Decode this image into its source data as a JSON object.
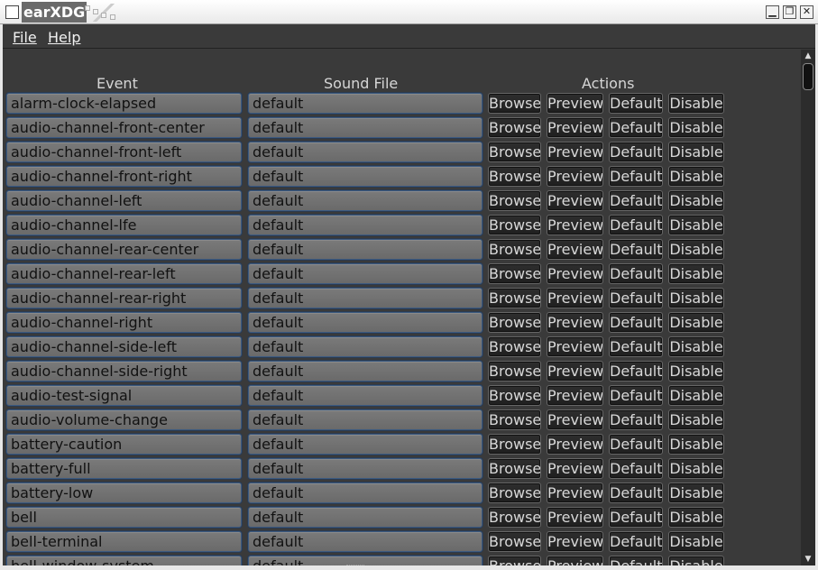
{
  "window": {
    "title": "earXDG",
    "controls": [
      "minimize",
      "maximize",
      "close"
    ]
  },
  "menu": {
    "file_label": "File",
    "help_label": "Help"
  },
  "columns": {
    "event": "Event",
    "sound_file": "Sound File",
    "actions": "Actions"
  },
  "actions": {
    "browse": "Browse",
    "preview": "Preview",
    "default": "Default",
    "disable": "Disable"
  },
  "rows": [
    {
      "event": "alarm-clock-elapsed",
      "sound": "default"
    },
    {
      "event": "audio-channel-front-center",
      "sound": "default"
    },
    {
      "event": "audio-channel-front-left",
      "sound": "default"
    },
    {
      "event": "audio-channel-front-right",
      "sound": "default"
    },
    {
      "event": "audio-channel-left",
      "sound": "default"
    },
    {
      "event": "audio-channel-lfe",
      "sound": "default"
    },
    {
      "event": "audio-channel-rear-center",
      "sound": "default"
    },
    {
      "event": "audio-channel-rear-left",
      "sound": "default"
    },
    {
      "event": "audio-channel-rear-right",
      "sound": "default"
    },
    {
      "event": "audio-channel-right",
      "sound": "default"
    },
    {
      "event": "audio-channel-side-left",
      "sound": "default"
    },
    {
      "event": "audio-channel-side-right",
      "sound": "default"
    },
    {
      "event": "audio-test-signal",
      "sound": "default"
    },
    {
      "event": "audio-volume-change",
      "sound": "default"
    },
    {
      "event": "battery-caution",
      "sound": "default"
    },
    {
      "event": "battery-full",
      "sound": "default"
    },
    {
      "event": "battery-low",
      "sound": "default"
    },
    {
      "event": "bell",
      "sound": "default"
    },
    {
      "event": "bell-terminal",
      "sound": "default"
    },
    {
      "event": "bell-window-system",
      "sound": "default"
    }
  ]
}
